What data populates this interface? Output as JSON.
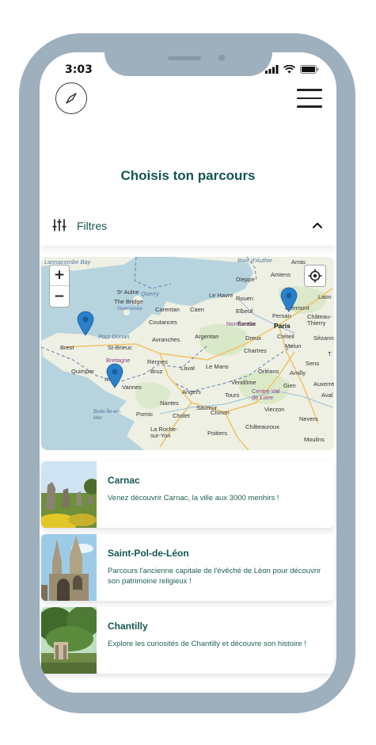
{
  "status_bar": {
    "time": "3:03"
  },
  "header": {
    "compass_icon": "compass-icon",
    "menu_icon": "hamburger-menu-icon"
  },
  "page": {
    "title": "Choisis ton parcours"
  },
  "filters": {
    "label": "Filtres",
    "icon": "sliders-icon",
    "toggle_icon": "chevron-up-icon",
    "expanded": true
  },
  "map": {
    "zoom_in_label": "+",
    "zoom_out_label": "−",
    "locate_icon": "crosshair-icon",
    "marker_color": "#2a81cb",
    "sea_labels": [
      "Lannacombe Bay",
      "Baie d'Authie",
      "Porz Donan"
    ],
    "region_labels": [
      "Normandie",
      "Bretagne",
      "Centre-Val de Loire"
    ],
    "major_cities": [
      "Paris"
    ],
    "cities": [
      "Arras",
      "Dieppe",
      "Amiens",
      "Le Havre",
      "Rouen",
      "Laon",
      "Clermont",
      "Carentan",
      "Caen",
      "Elbeuf",
      "The Bridge",
      "Guernesey",
      "Coutances",
      "Évreux",
      "Persan",
      "Château-Thierry",
      "Brest",
      "St-Brieuc",
      "Avranches",
      "Argentan",
      "Dreux",
      "Créteil",
      "Sézanne",
      "Chartres",
      "Melun",
      "Rennes",
      "Quimper",
      "Bruz",
      "Laval",
      "Le Mans",
      "Sens",
      "Orléans",
      "Amilly",
      "Vannes",
      "Vendôme",
      "Gien",
      "Auxerre",
      "Angers",
      "Tours",
      "Nantes",
      "Saumur",
      "Chinon",
      "Vierzon",
      "Pornic",
      "Cholet",
      "Belle-Île-en-Mer",
      "La Roche-sur-Yon",
      "Poitiers",
      "Châteauroux",
      "Nevers",
      "Moulins",
      "Aval",
      "5ᵉ Aulne",
      "Querry",
      "Ivry",
      "T"
    ]
  },
  "routes": [
    {
      "name": "Carnac",
      "description": "Venez découvrir Carnac, la ville aux 3000 menhirs !",
      "thumbnail": "menhirs-photo"
    },
    {
      "name": "Saint-Pol-de-Léon",
      "description": "Parcours l'ancienne capitale de l'évêché de Léon pour découvrir son patrimoine religieux !",
      "thumbnail": "cathedral-photo"
    },
    {
      "name": "Chantilly",
      "description": "Explore les curiosités de Chantilly et découvre son histoire !",
      "thumbnail": "park-photo"
    }
  ],
  "colors": {
    "frame": "#9eafbe",
    "accent": "#14564f",
    "land": "#eef0e4",
    "sea": "#b7d3de"
  }
}
